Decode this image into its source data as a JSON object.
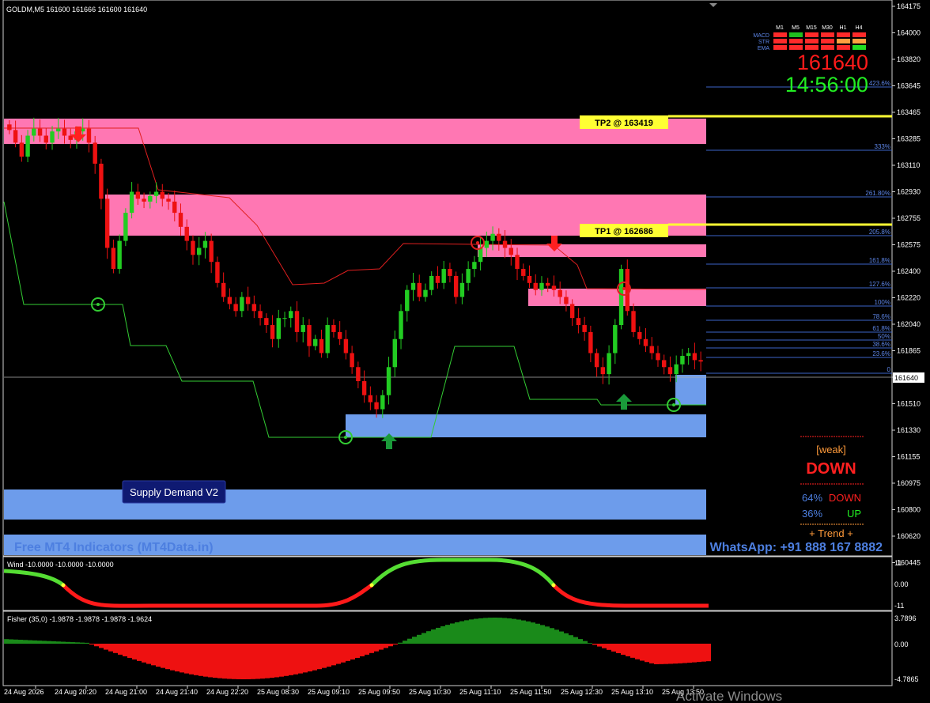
{
  "header": {
    "symbol_line": "GOLDM,M5  161600 161666 161600 161640"
  },
  "price_axis": {
    "ticks": [
      "164175",
      "164000",
      "163820",
      "163645",
      "163465",
      "163285",
      "163110",
      "162930",
      "162755",
      "162575",
      "162400",
      "162220",
      "162040",
      "161865",
      "161690",
      "161510",
      "161330",
      "161155",
      "160975",
      "160800",
      "160620",
      "160445"
    ],
    "current": "161640"
  },
  "time_axis": {
    "labels": [
      "24 Aug 2026",
      "24 Aug 20:20",
      "24 Aug 21:00",
      "24 Aug 21:40",
      "24 Aug 22:20",
      "25 Aug 08:30",
      "25 Aug 09:10",
      "25 Aug 09:50",
      "25 Aug 10:30",
      "25 Aug 11:10",
      "25 Aug 11:50",
      "25 Aug 12:30",
      "25 Aug 13:10",
      "25 Aug 13:50"
    ]
  },
  "dashboard": {
    "timeframes": [
      "M1",
      "M5",
      "M15",
      "M30",
      "H1",
      "H4"
    ],
    "rows": [
      {
        "label": "MACD",
        "colors": [
          "#ff2a2a",
          "#1fbf1f",
          "#ff2a2a",
          "#ff2a2a",
          "#ff2a2a",
          "#ff2a2a"
        ]
      },
      {
        "label": "STR",
        "colors": [
          "#ff2a2a",
          "#ff2a2a",
          "#ff2a2a",
          "#ff2a2a",
          "#ffa040",
          "#ffa040"
        ]
      },
      {
        "label": "EMA",
        "colors": [
          "#ff2a2a",
          "#ff2a2a",
          "#ff2a2a",
          "#ff2a2a",
          "#ff2a2a",
          "#22dd22"
        ]
      }
    ],
    "price": "161640",
    "clock": "14:56:00"
  },
  "fib_levels": [
    {
      "label": "423.6%",
      "y": 110
    },
    {
      "label": "333%",
      "y": 190
    },
    {
      "label": "261.80%",
      "y": 249
    },
    {
      "label": "205.8%",
      "y": 298
    },
    {
      "label": "161.8%",
      "y": 334
    },
    {
      "label": "127.6%",
      "y": 364
    },
    {
      "label": "100%",
      "y": 387
    },
    {
      "label": "78.6%",
      "y": 405
    },
    {
      "label": "61.8%",
      "y": 420
    },
    {
      "label": "50%",
      "y": 430
    },
    {
      "label": "38.6%",
      "y": 440
    },
    {
      "label": "23.6%",
      "y": 452
    },
    {
      "label": "0",
      "y": 472
    }
  ],
  "targets": {
    "tp2": "TP2 @ 163419",
    "tp1": "TP1 @ 162686"
  },
  "indicator_button": "Supply Demand V2",
  "watermark_left": "Free MT4 Indicators (MT4Data.in)",
  "watermark_right": "WhatsApp: +91 888 167 8882",
  "trend_panel": {
    "strength": "[weak]",
    "direction": "DOWN",
    "down_pct": "64%",
    "down_label": "DOWN",
    "up_pct": "36%",
    "up_label": "UP",
    "trend_label": "+   Trend   +"
  },
  "wind_panel": {
    "label": "Wind -10.0000 -10.0000 -10.0000",
    "ticks": [
      "11",
      "0.00",
      "-11"
    ]
  },
  "fisher_panel": {
    "label": "Fisher (35,0) -1.9878 -1.9878 -1.9878 -1.9624",
    "ticks": [
      "3.7896",
      "0.00",
      "-4.7865"
    ]
  },
  "os_watermark": "Activate Windows",
  "chart_data": {
    "type": "candlestick",
    "symbol": "GOLDM",
    "timeframe": "M5",
    "ohlc": {
      "open": 161600,
      "high": 161666,
      "low": 161600,
      "close": 161640
    },
    "ylim": [
      160400,
      164200
    ],
    "seed_closes": [
      163290,
      163200,
      163100,
      163250,
      163300,
      163250,
      163200,
      163280,
      163300,
      163250,
      163220,
      163280,
      163300,
      163200,
      163050,
      162800,
      162450,
      162300,
      162500,
      162700,
      162850,
      162800,
      162780,
      162820,
      162850,
      162800,
      162780,
      162700,
      162600,
      162500,
      162400,
      162450,
      162500,
      162350,
      162200,
      162100,
      162050,
      162000,
      162100,
      162050,
      162000,
      161950,
      161900,
      161800,
      161950,
      161950,
      162000,
      161850,
      161900,
      161750,
      161800,
      161700,
      161900,
      161850,
      161800,
      161700,
      161600,
      161500,
      161400,
      161350,
      161300,
      161400,
      161600,
      161800,
      162000,
      162150,
      162200,
      162100,
      162150,
      162250,
      162200,
      162300,
      162250,
      162100,
      162200,
      162300,
      162350,
      162450,
      162500,
      162550,
      162500,
      162450,
      162400,
      162300,
      162250,
      162200,
      162150,
      162200,
      162180,
      162150,
      162100,
      162050,
      161950,
      161900,
      161850,
      161700,
      161600,
      161550,
      161700,
      161900,
      162300,
      162000,
      161850,
      161800,
      161750,
      161700,
      161650,
      161600,
      161550,
      161620,
      161680,
      161700,
      161650,
      161640
    ]
  }
}
